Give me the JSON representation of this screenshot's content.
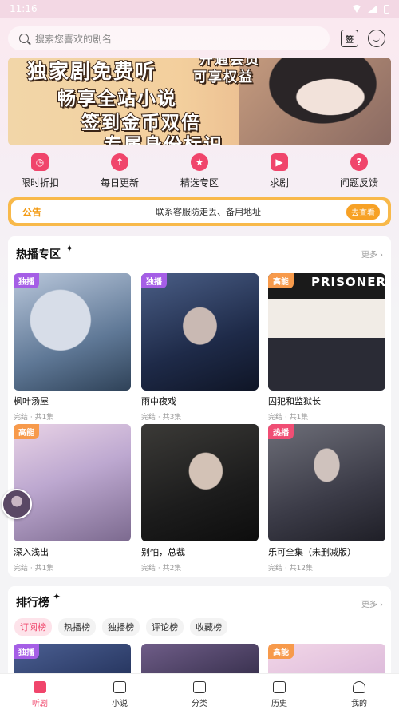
{
  "status_bar": {
    "time": "11:16"
  },
  "search": {
    "placeholder": "搜索您喜欢的剧名"
  },
  "top_icons": {
    "sign_icon_text": "签"
  },
  "banner": {
    "lines": [
      "独家剧免费听",
      "畅享全站小说",
      "签到金币双倍",
      "专属身份标识",
      "可享权益",
      "开通会员"
    ]
  },
  "quick_nav": [
    {
      "label": "限时折扣",
      "icon": "timer-icon"
    },
    {
      "label": "每日更新",
      "icon": "arrow-up-icon"
    },
    {
      "label": "精选专区",
      "icon": "star-icon"
    },
    {
      "label": "求剧",
      "icon": "play-icon"
    },
    {
      "label": "问题反馈",
      "icon": "question-icon"
    }
  ],
  "notice": {
    "tag": "公告",
    "text": "联系客服防走丢、备用地址",
    "button": "去查看"
  },
  "hot_section": {
    "title": "热播专区",
    "more": "更多 ›",
    "items": [
      {
        "title": "枫叶汤屋",
        "meta": "完结 · 共1集",
        "badge": "独播"
      },
      {
        "title": "雨中夜戏",
        "meta": "完结 · 共3集",
        "badge": "独播"
      },
      {
        "title": "囚犯和监狱长",
        "meta": "完结 · 共1集",
        "badge": "高能",
        "cover_text": "PRISONER"
      },
      {
        "title": "深入浅出",
        "meta": "完结 · 共1集",
        "badge": "高能"
      },
      {
        "title": "别怕，总裁",
        "meta": "完结 · 共2集",
        "badge": ""
      },
      {
        "title": "乐可全集（未删减版）",
        "meta": "完结 · 共12集",
        "badge": "热播"
      }
    ]
  },
  "rank_section": {
    "title": "排行榜",
    "more": "更多 ›",
    "tabs": [
      "订阅榜",
      "热播榜",
      "独播榜",
      "评论榜",
      "收藏榜"
    ],
    "badges": [
      "独播",
      "",
      "高能"
    ]
  },
  "tabbar": [
    {
      "label": "听剧",
      "active": true
    },
    {
      "label": "小说",
      "active": false
    },
    {
      "label": "分类",
      "active": false
    },
    {
      "label": "历史",
      "active": false
    },
    {
      "label": "我的",
      "active": false
    }
  ]
}
